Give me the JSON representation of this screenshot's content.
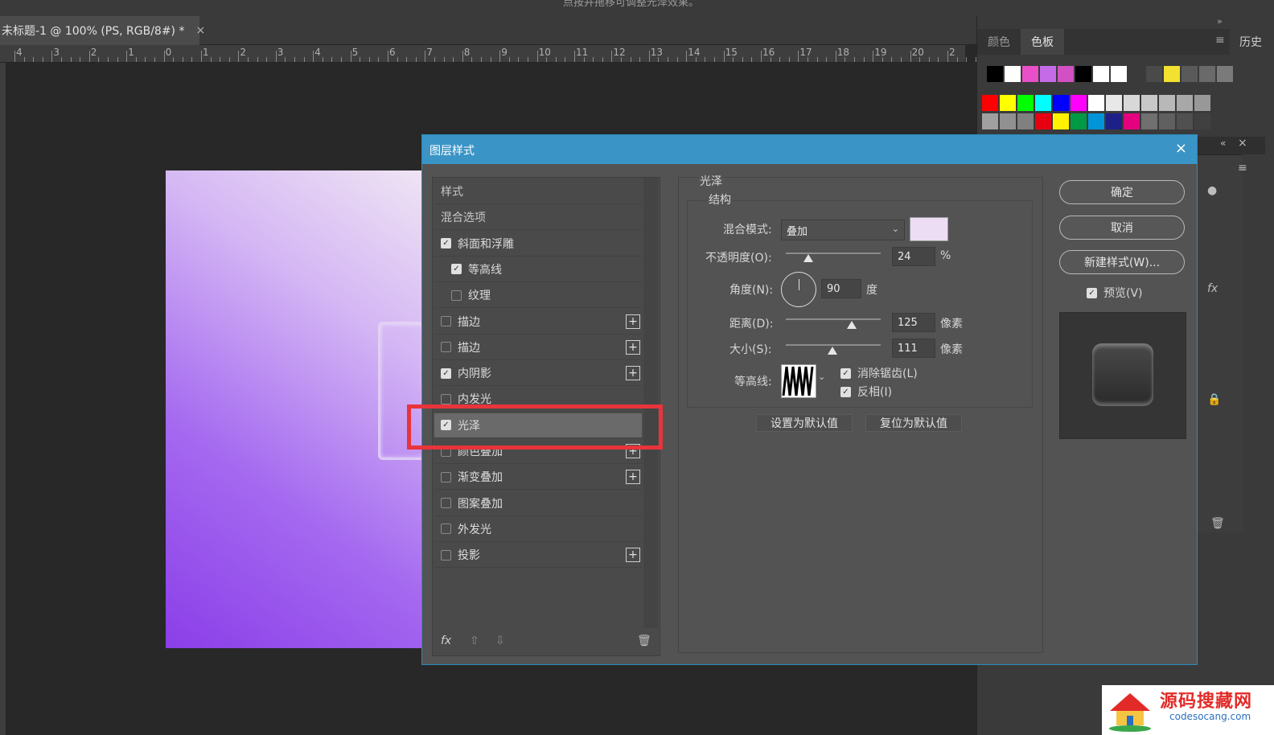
{
  "window": {
    "top_message": "点按并拖移可调整光泽效果。",
    "doc_tab_title": "未标题-1 @ 100% (PS, RGB/8#) *",
    "doc_tab_close": "×"
  },
  "ruler": {
    "labels": [
      "4",
      "3",
      "2",
      "1",
      "0",
      "1",
      "2",
      "3",
      "4",
      "5",
      "6",
      "7",
      "8",
      "9",
      "10",
      "11",
      "12",
      "13",
      "14",
      "15",
      "16",
      "17",
      "18",
      "19",
      "20",
      "2"
    ]
  },
  "right_panel": {
    "tabs": [
      "颜色",
      "色板"
    ],
    "active_tab": "色板",
    "history_tab": "历史",
    "menu_icon": "≡",
    "expand_icon": "»",
    "collapse_icon": "«",
    "close_icon": "×",
    "swatches_row1": [
      "#000000",
      "#ffffff",
      "#e84fc8",
      "#c56be8",
      "#d34fc4",
      "#000000",
      "#ffffff",
      "#ffffff",
      "#3a3a3a",
      "#4a4a4a",
      "#f2e12f",
      "#5a5a5a",
      "#6a6a6a",
      "#7a7a7a"
    ],
    "swatches_row2": [
      "#ff0000",
      "#ffff00",
      "#00ff00",
      "#00ffff",
      "#0000ff",
      "#ff00ff",
      "#ffffff",
      "#e8e8e8",
      "#d8d8d8",
      "#c8c8c8",
      "#b8b8b8",
      "#a8a8a8",
      "#989898"
    ],
    "swatches_row3": [
      "#a0a0a0",
      "#909090",
      "#808080",
      "#e60012",
      "#fff100",
      "#009944",
      "#0095d9",
      "#1d2088",
      "#e4007f",
      "#707070",
      "#606060",
      "#505050",
      "#404040"
    ]
  },
  "dialog": {
    "title": "图层样式",
    "close": "×",
    "styles": [
      {
        "label": "样式",
        "type": "header"
      },
      {
        "label": "混合选项",
        "type": "header"
      },
      {
        "label": "斜面和浮雕",
        "checked": true,
        "indent": 0
      },
      {
        "label": "等高线",
        "checked": true,
        "indent": 1
      },
      {
        "label": "纹理",
        "checked": false,
        "indent": 1
      },
      {
        "label": "描边",
        "checked": false,
        "indent": 0,
        "plus": true
      },
      {
        "label": "描边",
        "checked": false,
        "indent": 0,
        "plus": true
      },
      {
        "label": "内阴影",
        "checked": true,
        "indent": 0,
        "plus": true
      },
      {
        "label": "内发光",
        "checked": false,
        "indent": 0
      },
      {
        "label": "光泽",
        "checked": true,
        "indent": 0,
        "selected": true
      },
      {
        "label": "颜色叠加",
        "checked": false,
        "indent": 0,
        "plus": true
      },
      {
        "label": "渐变叠加",
        "checked": false,
        "indent": 0,
        "plus": true
      },
      {
        "label": "图案叠加",
        "checked": false,
        "indent": 0
      },
      {
        "label": "外发光",
        "checked": false,
        "indent": 0
      },
      {
        "label": "投影",
        "checked": false,
        "indent": 0,
        "plus": true
      }
    ],
    "footer": {
      "fx": "fx",
      "up": "⇧",
      "down": "⇩",
      "trash": "🗑"
    },
    "satin": {
      "section": "光泽",
      "group": "结构",
      "blend_mode_label": "混合模式:",
      "blend_mode_value": "叠加",
      "blend_color": "#ecdcf4",
      "opacity_label": "不透明度(O):",
      "opacity_value": "24",
      "opacity_unit": "%",
      "angle_label": "角度(N):",
      "angle_value": "90",
      "angle_unit": "度",
      "distance_label": "距离(D):",
      "distance_value": "125",
      "distance_unit": "像素",
      "size_label": "大小(S):",
      "size_value": "111",
      "size_unit": "像素",
      "contour_label": "等高线:",
      "antialias_label": "消除锯齿(L)",
      "antialias_checked": true,
      "invert_label": "反相(I)",
      "invert_checked": true,
      "set_default": "设置为默认值",
      "reset_default": "复位为默认值"
    },
    "buttons": {
      "ok": "确定",
      "cancel": "取消",
      "new_style": "新建样式(W)...",
      "preview_label": "预览(V)",
      "preview_checked": true
    }
  },
  "watermark": {
    "title": "源码搜藏网",
    "url": "codesocang.com"
  }
}
